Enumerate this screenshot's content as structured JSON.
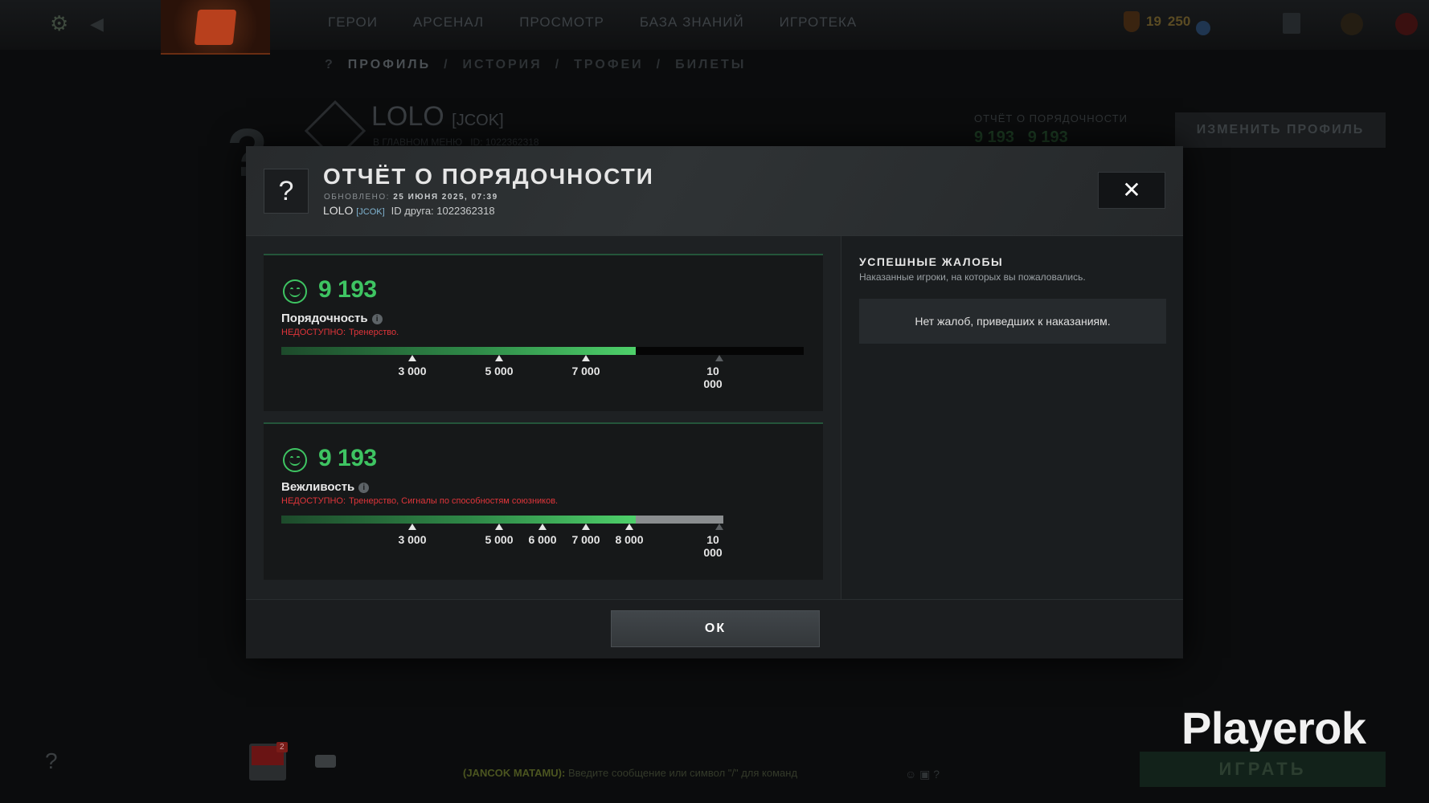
{
  "background": {
    "nav": [
      "ГЕРОИ",
      "АРСЕНАЛ",
      "ПРОСМОТР",
      "БАЗА ЗНАНИЙ",
      "ИГРОТЕКА"
    ],
    "currency": {
      "a": "19",
      "b": "250"
    },
    "subnav": {
      "help": "?",
      "profile": "ПРОФИЛЬ",
      "history": "ИСТОРИЯ",
      "trophies": "ТРОФЕИ",
      "tickets": "БИЛЕТЫ",
      "sep": "/"
    },
    "profile": {
      "name": "LOLO",
      "tag": "[JCOK]",
      "status": "В ГЛАВНОМ МЕНЮ",
      "id": "ID: 1022362318"
    },
    "report_mini": {
      "title": "ОТЧЁТ О ПОРЯДОЧНОСТИ",
      "v1": "9 193",
      "v2": "9 193"
    },
    "edit_profile": "ИЗМЕНИТЬ ПРОФИЛЬ",
    "party_badge": "2",
    "chat": {
      "channel": "(JANCOK MATAMU):",
      "placeholder": "Введите сообщение или символ \"/\" для команд"
    },
    "brand": "Playerok",
    "play": "ИГРАТЬ"
  },
  "modal": {
    "title": "ОТЧЁТ О ПОРЯДОЧНОСТИ",
    "updated_label": "ОБНОВЛЕНО:",
    "updated_value": "25 ИЮНЯ 2025, 07:39",
    "user_name": "LOLO",
    "user_tag": "[JCOK]",
    "friend_id": "ID друга: 1022362318",
    "close_icon": "close-icon",
    "ok": "ОК"
  },
  "cards": [
    {
      "score": "9 193",
      "label": "Порядочность",
      "warn_label": "НЕДОСТУПНО:",
      "warn_reason": "Тренерство.",
      "value": 9193,
      "max_shown": 10000,
      "ticks": [
        "3 000",
        "5 000",
        "7 000"
      ],
      "end_tick": [
        "10",
        "000"
      ]
    },
    {
      "score": "9 193",
      "label": "Вежливость",
      "warn_label": "НЕДОСТУПНО:",
      "warn_reason": "Тренерство, Сигналы по способностям союзников.",
      "value": 9193,
      "max_shown": 10000,
      "ticks": [
        "3 000",
        "5 000",
        "6 000",
        "7 000",
        "8 000"
      ],
      "end_tick": [
        "10",
        "000"
      ]
    }
  ],
  "reports": {
    "title": "УСПЕШНЫЕ ЖАЛОБЫ",
    "subtitle": "Наказанные игроки, на которых вы пожаловались.",
    "empty": "Нет жалоб, приведших к наказаниям."
  },
  "colors": {
    "accent_green": "#3ec462",
    "warn_red": "#e0353a",
    "tag_blue": "#7fb3d0"
  }
}
